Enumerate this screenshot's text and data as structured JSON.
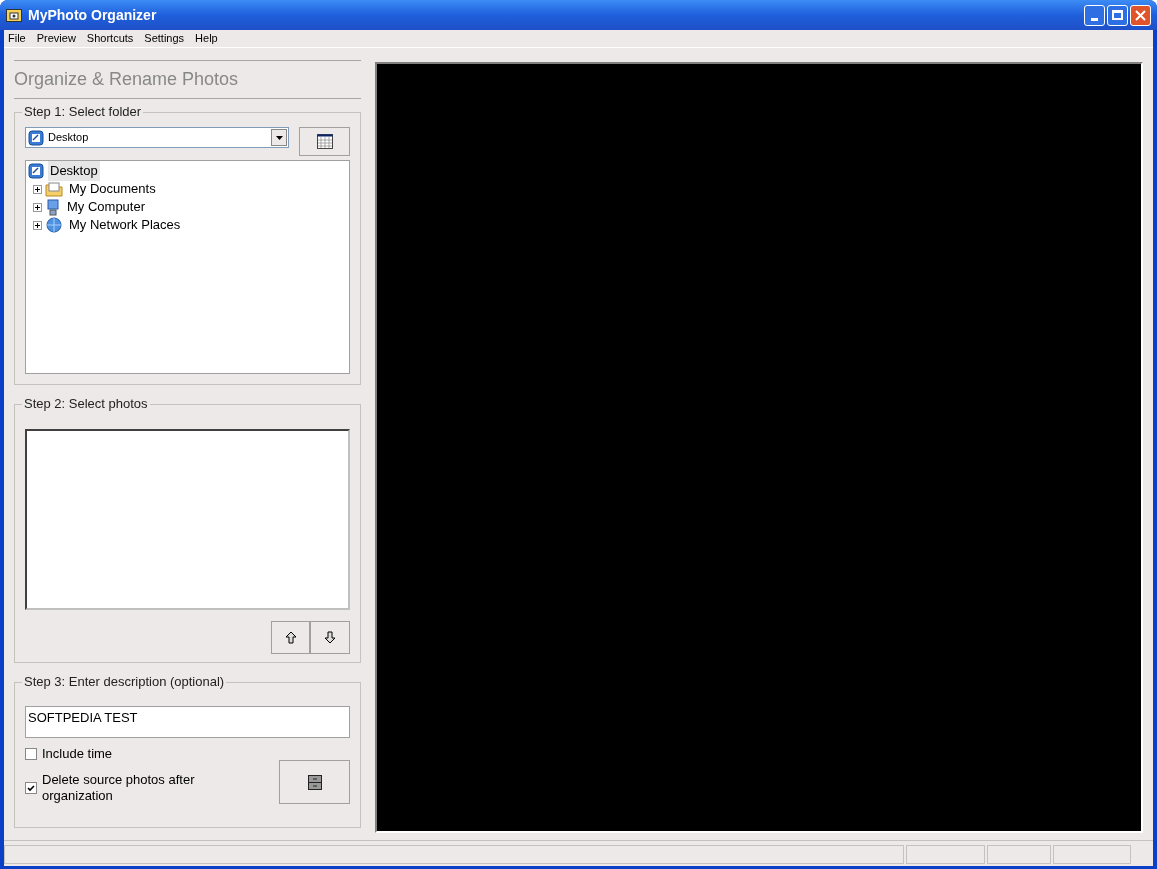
{
  "window": {
    "title": "MyPhoto Organizer"
  },
  "menu": [
    "File",
    "Preview",
    "Shortcuts",
    "Settings",
    "Help"
  ],
  "heading": "Organize & Rename Photos",
  "step1": {
    "legend": "Step 1: Select folder",
    "dropdown_value": "Desktop",
    "tree": [
      {
        "label": "Desktop",
        "kind": "desktop",
        "selected": true,
        "children": [
          {
            "label": "My Documents",
            "kind": "documents",
            "selected": false,
            "expanded": false
          },
          {
            "label": "My Computer",
            "kind": "computer",
            "selected": false,
            "expanded": false
          },
          {
            "label": "My Network Places",
            "kind": "network",
            "selected": false,
            "expanded": false
          }
        ]
      }
    ]
  },
  "step2": {
    "legend": "Step 2: Select photos"
  },
  "step3": {
    "legend": "Step 3: Enter description (optional)",
    "description": "SOFTPEDIA TEST",
    "options": [
      {
        "label": "Include time",
        "checked": false
      },
      {
        "label": "Delete source photos after organization",
        "checked": true
      }
    ]
  }
}
